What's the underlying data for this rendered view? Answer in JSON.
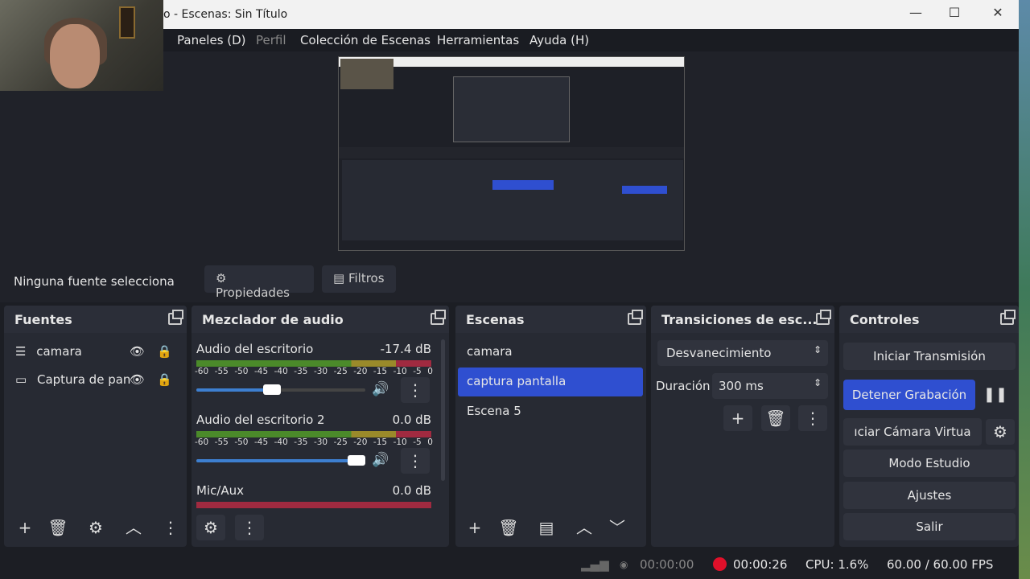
{
  "window": {
    "title": "o - Escenas: Sin Título",
    "minimize": "—",
    "maximize": "☐",
    "close": "✕"
  },
  "menu": [
    "Paneles (D)",
    "Perfil",
    "Colección de Escenas",
    "Herramientas",
    "Ayuda (H)"
  ],
  "source_bar": {
    "status": "Ninguna fuente selecciona",
    "properties": "Propiedades",
    "filters": "Filtros"
  },
  "sources": {
    "title": "Fuentes",
    "items": [
      {
        "name": "camara",
        "icon": "list-icon"
      },
      {
        "name": "Captura de pan",
        "icon": "monitor-icon"
      }
    ]
  },
  "mixer": {
    "title": "Mezclador de audio",
    "ticks": [
      "-60",
      "-55",
      "-50",
      "-45",
      "-40",
      "-35",
      "-30",
      "-25",
      "-20",
      "-15",
      "-10",
      "-5",
      "0"
    ],
    "channels": [
      {
        "name": "Audio del escritorio",
        "db": "-17.4 dB",
        "volume": 0.5
      },
      {
        "name": "Audio del escritorio 2",
        "db": "0.0 dB",
        "volume": 1.0
      },
      {
        "name": "Mic/Aux",
        "db": "0.0 dB"
      }
    ]
  },
  "scenes": {
    "title": "Escenas",
    "items": [
      "camara",
      "captura pantalla",
      "Escena 5"
    ],
    "selected": 1
  },
  "transitions": {
    "title": "Transiciones de esc...",
    "type": "Desvanecimiento",
    "duration_label": "Duración",
    "duration": "300 ms"
  },
  "controls": {
    "title": "Controles",
    "stream": "Iniciar Transmisión",
    "record": "Detener Grabación",
    "virtualcam": "ıciar Cámara Virtua",
    "studio": "Modo Estudio",
    "settings": "Ajustes",
    "exit": "Salir"
  },
  "status": {
    "stream_time": "00:00:00",
    "rec_time": "00:00:26",
    "cpu": "CPU: 1.6%",
    "fps": "60.00 / 60.00 FPS"
  },
  "colors": {
    "accent": "#2f4fd0",
    "record": "#e0102a"
  }
}
